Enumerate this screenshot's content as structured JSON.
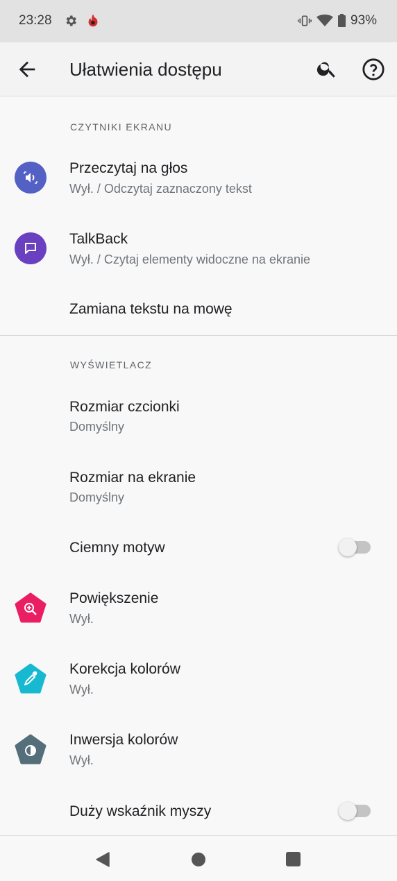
{
  "status_bar": {
    "time": "23:28",
    "battery": "93%",
    "icons": [
      "gear-icon",
      "app-notification-icon",
      "vibrate-icon",
      "wifi-icon",
      "battery-icon"
    ]
  },
  "app_bar": {
    "title": "Ułatwienia dostępu",
    "icons": [
      "back-arrow-icon",
      "search-icon",
      "help-icon"
    ]
  },
  "sections": {
    "screen_readers": {
      "header": "CZYTNIKI EKRANU",
      "items": [
        {
          "title": "Przeczytaj na głos",
          "subtitle": "Wył. / Odczytaj zaznaczony tekst",
          "icon": "select-to-speak-icon",
          "icon_color": "#5361c4"
        },
        {
          "title": "TalkBack",
          "subtitle": "Wył. / Czytaj elementy widoczne na ekranie",
          "icon": "talkback-icon",
          "icon_color": "#6a3fc0"
        },
        {
          "title": "Zamiana tekstu na mowę"
        }
      ]
    },
    "display": {
      "header": "WYŚWIETLACZ",
      "items": [
        {
          "title": "Rozmiar czcionki",
          "subtitle": "Domyślny"
        },
        {
          "title": "Rozmiar na ekranie",
          "subtitle": "Domyślny"
        },
        {
          "title": "Ciemny motyw",
          "toggle_on": false
        },
        {
          "title": "Powiększenie",
          "subtitle": "Wył.",
          "icon": "magnification-icon",
          "icon_color": "#e91e63"
        },
        {
          "title": "Korekcja kolorów",
          "subtitle": "Wył.",
          "icon": "color-correction-icon",
          "icon_color": "#17b9d0"
        },
        {
          "title": "Inwersja kolorów",
          "subtitle": "Wył.",
          "icon": "color-inversion-icon",
          "icon_color": "#546e7a"
        },
        {
          "title": "Duży wskaźnik myszy",
          "toggle_on": false
        }
      ]
    }
  },
  "nav_bar": {
    "icons": [
      "nav-back-icon",
      "nav-home-icon",
      "nav-recents-icon"
    ]
  }
}
